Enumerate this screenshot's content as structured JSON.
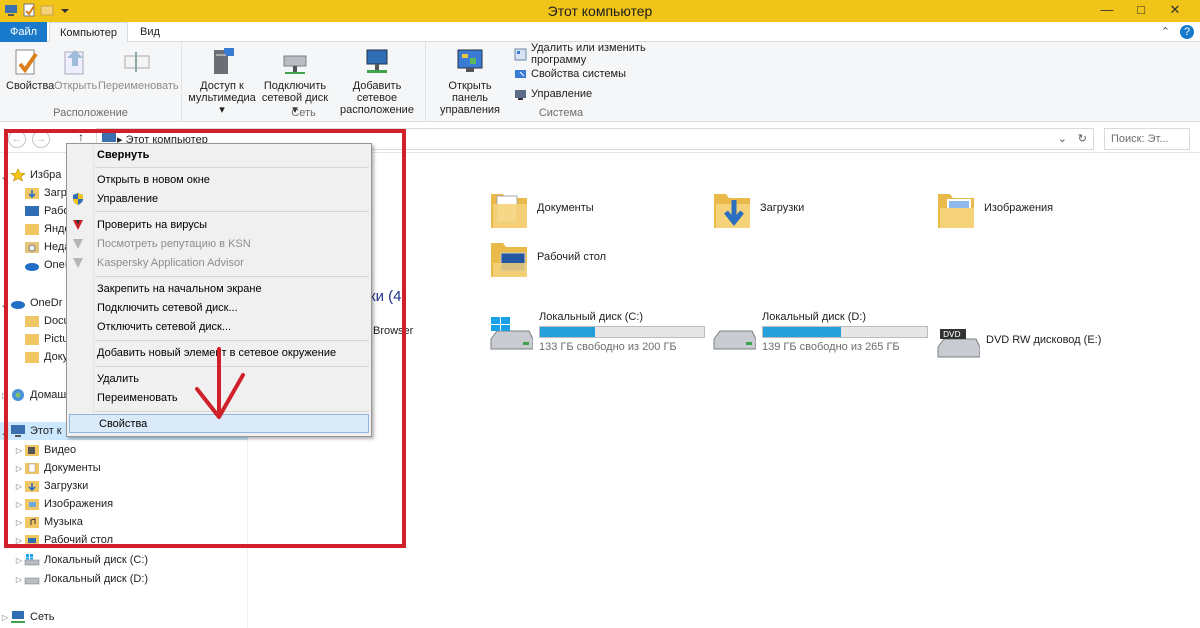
{
  "window": {
    "title": "Этот компьютер",
    "controls": {
      "minimize": "—",
      "maximize": "□",
      "close": "✕"
    }
  },
  "ribbon_tabs": {
    "file": "Файл",
    "computer": "Компьютер",
    "view": "Вид",
    "expand": "⌃",
    "help": "?"
  },
  "ribbon": {
    "location": {
      "label": "Расположение",
      "properties": "Свойства",
      "open": "Открыть",
      "rename": "Переименовать"
    },
    "network": {
      "label": "Сеть",
      "media_access": [
        "Доступ к",
        "мультимедиа ▾"
      ],
      "map_drive": [
        "Подключить",
        "сетевой диск ▾"
      ],
      "add_location": [
        "Добавить сетевое",
        "расположение"
      ]
    },
    "system": {
      "label": "Система",
      "control_panel": [
        "Открыть панель",
        "управления"
      ],
      "uninstall": "Удалить или изменить программу",
      "sys_props": "Свойства системы",
      "manage": "Управление"
    }
  },
  "address": {
    "back": "←",
    "forward": "→",
    "up": "↑",
    "path": "▸  Этот компьютер",
    "dropdown": "⌄",
    "refresh": "↻",
    "search_placeholder": "Поиск: Эт..."
  },
  "nav": {
    "favorites": "Избра",
    "fav_items": [
      "Загр",
      "Рабо",
      "Янде",
      "Неда",
      "OneI"
    ],
    "onedrive": "OneDr",
    "onedrive_items": [
      "Docu",
      "Pictu",
      "Доку"
    ],
    "homegroup": "Домаш",
    "this_pc": "Этот к",
    "pc_items": [
      "Видео",
      "Документы",
      "Загрузки",
      "Изображения",
      "Музыка",
      "Рабочий стол",
      "Локальный диск (C:)",
      "Локальный диск (D:)"
    ],
    "network": "Сеть"
  },
  "content": {
    "folders": [
      "Документы",
      "Загрузки",
      "Изображения",
      "Рабочий стол"
    ],
    "devices_header": "ки (4)",
    "browser_fragment": "Browser",
    "drives": [
      {
        "name": "Локальный диск (C:)",
        "free": "133 ГБ свободно из 200 ГБ",
        "used_fraction": 0.335
      },
      {
        "name": "Локальный диск (D:)",
        "free": "139 ГБ свободно из 265 ГБ",
        "used_fraction": 0.475
      }
    ],
    "dvd": "DVD RW дисковод (E:)"
  },
  "context_menu": {
    "collapse": "Свернуть",
    "open_new": "Открыть в новом окне",
    "manage": "Управление",
    "scan": "Проверить на вирусы",
    "ksn": "Посмотреть репутацию в KSN",
    "advisor": "Kaspersky Application Advisor",
    "pin": "Закрепить на начальном экране",
    "map": "Подключить сетевой диск...",
    "disconnect": "Отключить сетевой диск...",
    "add_net": "Добавить новый элемент в сетевое окружение",
    "delete": "Удалить",
    "rename": "Переименовать",
    "properties": "Свойства"
  },
  "colors": {
    "accent": "#1979ca",
    "titlebar": "#f0c419",
    "highlight": "#d0202a",
    "drive_bar": "#26a0da"
  }
}
